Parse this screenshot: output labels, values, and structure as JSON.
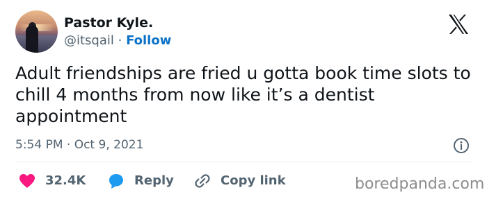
{
  "author": {
    "name": "Pastor Kyle.",
    "handle": "@itsqail",
    "separator": " · ",
    "follow_label": "Follow"
  },
  "tweet": {
    "text": "Adult friendships are fried u gotta book time slots to chill 4 months from now like it’s a dentist appointment",
    "timestamp": "5:54 PM · Oct 9, 2021"
  },
  "actions": {
    "like_count": "32.4K",
    "reply_label": "Reply",
    "copy_label": "Copy link"
  },
  "watermark": "boredpanda.com",
  "colors": {
    "accent": "#0b72c8",
    "like": "#f91880",
    "reply": "#1d9bf0",
    "muted": "#536471",
    "text": "#0f1419"
  },
  "icons": [
    "x-logo-icon",
    "info-icon",
    "heart-icon",
    "reply-bubble-icon",
    "link-icon"
  ]
}
